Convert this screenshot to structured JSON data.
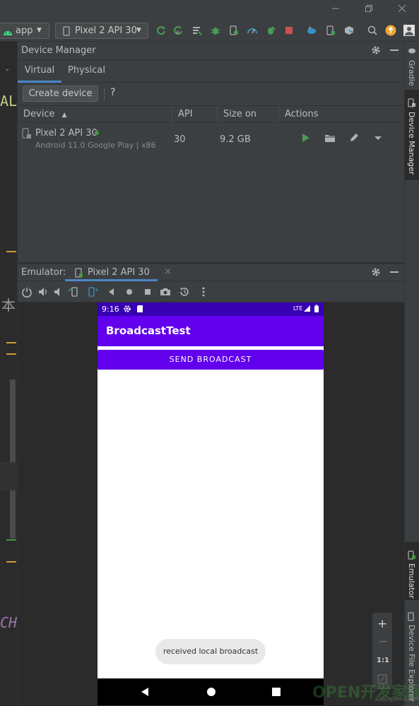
{
  "toolbar": {
    "run_config": "app",
    "device_selector": "Pixel 2 API 30"
  },
  "editor_fragments": {
    "text_al": "AL",
    "text_cjk": "本",
    "text_cho": "CHO"
  },
  "device_manager": {
    "title": "Device Manager",
    "tabs": [
      {
        "label": "Virtual",
        "active": true
      },
      {
        "label": "Physical",
        "active": false
      }
    ],
    "create_device_label": "Create device",
    "help_label": "?",
    "columns": [
      "Device",
      "API",
      "Size on Disk",
      "Actions"
    ],
    "sort_indicator": "▲",
    "devices": [
      {
        "name": "Pixel 2 API 30",
        "subtitle": "Android 11.0 Google Play | x86",
        "api": "30",
        "size": "9.2 GB",
        "online": true
      }
    ]
  },
  "emulator": {
    "label": "Emulator:",
    "tab_label": "Pixel 2 API 30",
    "tab_close": "×"
  },
  "phone": {
    "time": "9:16",
    "network": "LTE",
    "app_title": "BroadcastTest",
    "send_button": "SEND BROADCAST",
    "toast": "received local broadcast"
  },
  "zoom_controls": {
    "zoom_in": "+",
    "zoom_out": "−",
    "actual_size": "1:1"
  },
  "right_tabs": {
    "gradle": "Gradle",
    "device_manager": "Device Manager",
    "emulator": "Emulator",
    "device_file_explorer": "Device File Explorer"
  },
  "watermark": {
    "text": "OPEN开发家园",
    "url": "www.openhs.com"
  },
  "colors": {
    "ide_bg": "#2b2b2b",
    "panel_bg": "#3c3f41",
    "accent": "#4a88c7",
    "app_primary": "#6200ee",
    "app_status": "#3700b3",
    "run_green": "#499c54",
    "stop_red": "#c75450",
    "online_green": "#3e9b3e"
  }
}
